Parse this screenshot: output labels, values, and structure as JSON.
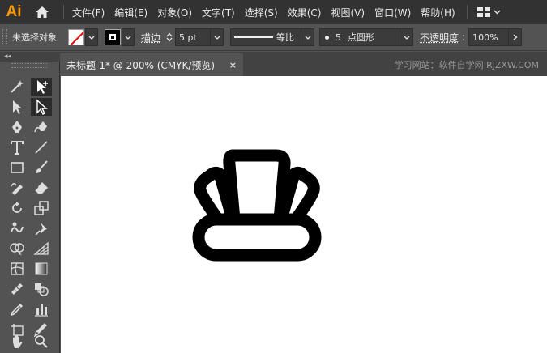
{
  "app": {
    "logo_text": "Ai"
  },
  "menu": {
    "items": [
      {
        "label": "文件(F)"
      },
      {
        "label": "编辑(E)"
      },
      {
        "label": "对象(O)"
      },
      {
        "label": "文字(T)"
      },
      {
        "label": "选择(S)"
      },
      {
        "label": "效果(C)"
      },
      {
        "label": "视图(V)"
      },
      {
        "label": "窗口(W)"
      },
      {
        "label": "帮助(H)"
      }
    ]
  },
  "control_bar": {
    "selection_status": "未选择对象",
    "stroke_label": "描边",
    "stroke_width": "5 pt",
    "profile_label": "等比",
    "brush_size": "5",
    "brush_label": "点圆形",
    "opacity_label": "不透明度",
    "opacity_value": "100%"
  },
  "tabs": {
    "collapse_glyph": "◂◂",
    "document": {
      "title": "未标题-1* @ 200% (CMYK/预览)",
      "close_glyph": "×"
    },
    "watermark": "学习网站：软件自学网 RJZXW.COM"
  },
  "toolbar": {
    "tools": [
      "magic-wand-icon",
      "add-anchor-icon",
      "selection-arrow-icon",
      "direct-selection-icon",
      "pen-icon",
      "curvature-pen-icon",
      "type-icon",
      "line-icon",
      "rectangle-icon",
      "paintbrush-icon",
      "shaper-icon",
      "eraser-icon",
      "rotate-icon",
      "scale-icon",
      "warp-icon",
      "puppet-pin-icon",
      "shape-builder-icon",
      "perspective-grid-icon",
      "mesh-icon",
      "gradient-icon",
      "eyedropper-ruler-icon",
      "blend-icon",
      "eyedropper-icon",
      "bar-graph-icon",
      "artboard-icon",
      "slice-icon",
      "hand-icon",
      "zoom-icon"
    ]
  },
  "colors": {
    "menubar_bg": "#323232",
    "panel_bg": "#535353",
    "tabbar_bg": "#424242",
    "canvas_bg": "#ffffff",
    "logo": "#ff9a00",
    "artwork_stroke": "#000000"
  }
}
